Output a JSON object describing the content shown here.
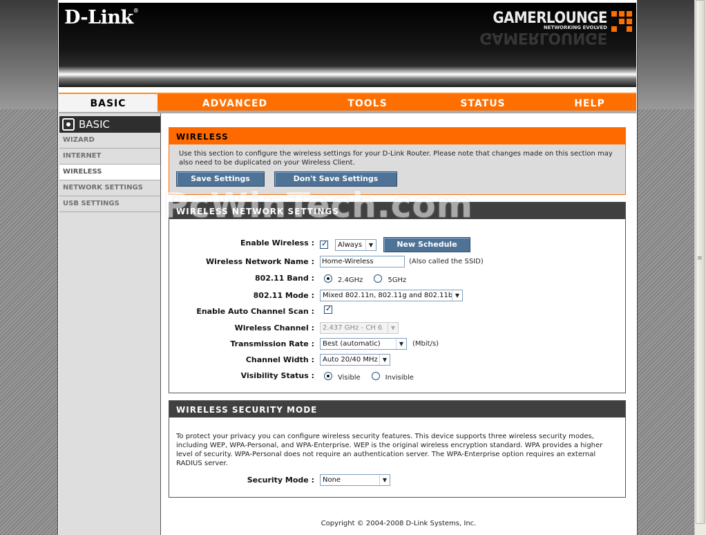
{
  "header": {
    "logo_text": "D-Link",
    "logo_reg": "®",
    "brand_name": "GAMERLOUNGE",
    "brand_tagline": "NETWORKING EVOLVED"
  },
  "nav": {
    "tabs": [
      {
        "label": "BASIC",
        "active": true
      },
      {
        "label": "ADVANCED"
      },
      {
        "label": "TOOLS"
      },
      {
        "label": "STATUS"
      },
      {
        "label": "HELP"
      }
    ]
  },
  "sidebar": {
    "title": "BASIC",
    "items": [
      {
        "label": "WIZARD"
      },
      {
        "label": "INTERNET"
      },
      {
        "label": "WIRELESS",
        "active": true
      },
      {
        "label": "NETWORK SETTINGS"
      },
      {
        "label": "USB SETTINGS"
      }
    ]
  },
  "wireless": {
    "title": "WIRELESS",
    "intro": "Use this section to configure the wireless settings for your D-Link Router. Please note that changes made on this section may also need to be duplicated on your Wireless Client.",
    "save_label": "Save Settings",
    "dont_save_label": "Don't Save Settings"
  },
  "network_settings": {
    "title": "WIRELESS NETWORK SETTINGS",
    "enable_wireless": {
      "label": "Enable Wireless :",
      "checked": true,
      "schedule": "Always",
      "new_schedule": "New Schedule"
    },
    "network_name": {
      "label": "Wireless Network Name :",
      "value": "Home-Wireless",
      "note": "(Also called the SSID)"
    },
    "band": {
      "label": "802.11 Band :",
      "opt1": "2.4GHz",
      "opt2": "5GHz",
      "selected": "2.4GHz"
    },
    "mode": {
      "label": "802.11 Mode :",
      "value": "Mixed 802.11n, 802.11g and 802.11b"
    },
    "auto_channel": {
      "label": "Enable Auto Channel Scan :",
      "checked": true
    },
    "channel": {
      "label": "Wireless Channel :",
      "value": "2.437 GHz - CH 6"
    },
    "rate": {
      "label": "Transmission Rate :",
      "value": "Best (automatic)",
      "unit": "(Mbit/s)"
    },
    "width": {
      "label": "Channel Width :",
      "value": "Auto 20/40 MHz"
    },
    "visibility": {
      "label": "Visibility Status :",
      "opt1": "Visible",
      "opt2": "Invisible",
      "selected": "Visible"
    }
  },
  "security": {
    "title": "WIRELESS SECURITY MODE",
    "intro": "To protect your privacy you can configure wireless security features. This device supports three wireless security modes, including WEP, WPA-Personal, and WPA-Enterprise. WEP is the original wireless encryption standard. WPA provides a higher level of security. WPA-Personal does not require an authentication server. The WPA-Enterprise option requires an external RADIUS server.",
    "mode_label": "Security Mode :",
    "mode_value": "None"
  },
  "footer": {
    "copyright": "Copyright © 2004-2008 D-Link Systems, Inc."
  },
  "watermark": "PcWinTech.com",
  "colors": {
    "accent": "#ff6f00",
    "panel_dark": "#404040",
    "button": "#4f7396"
  }
}
